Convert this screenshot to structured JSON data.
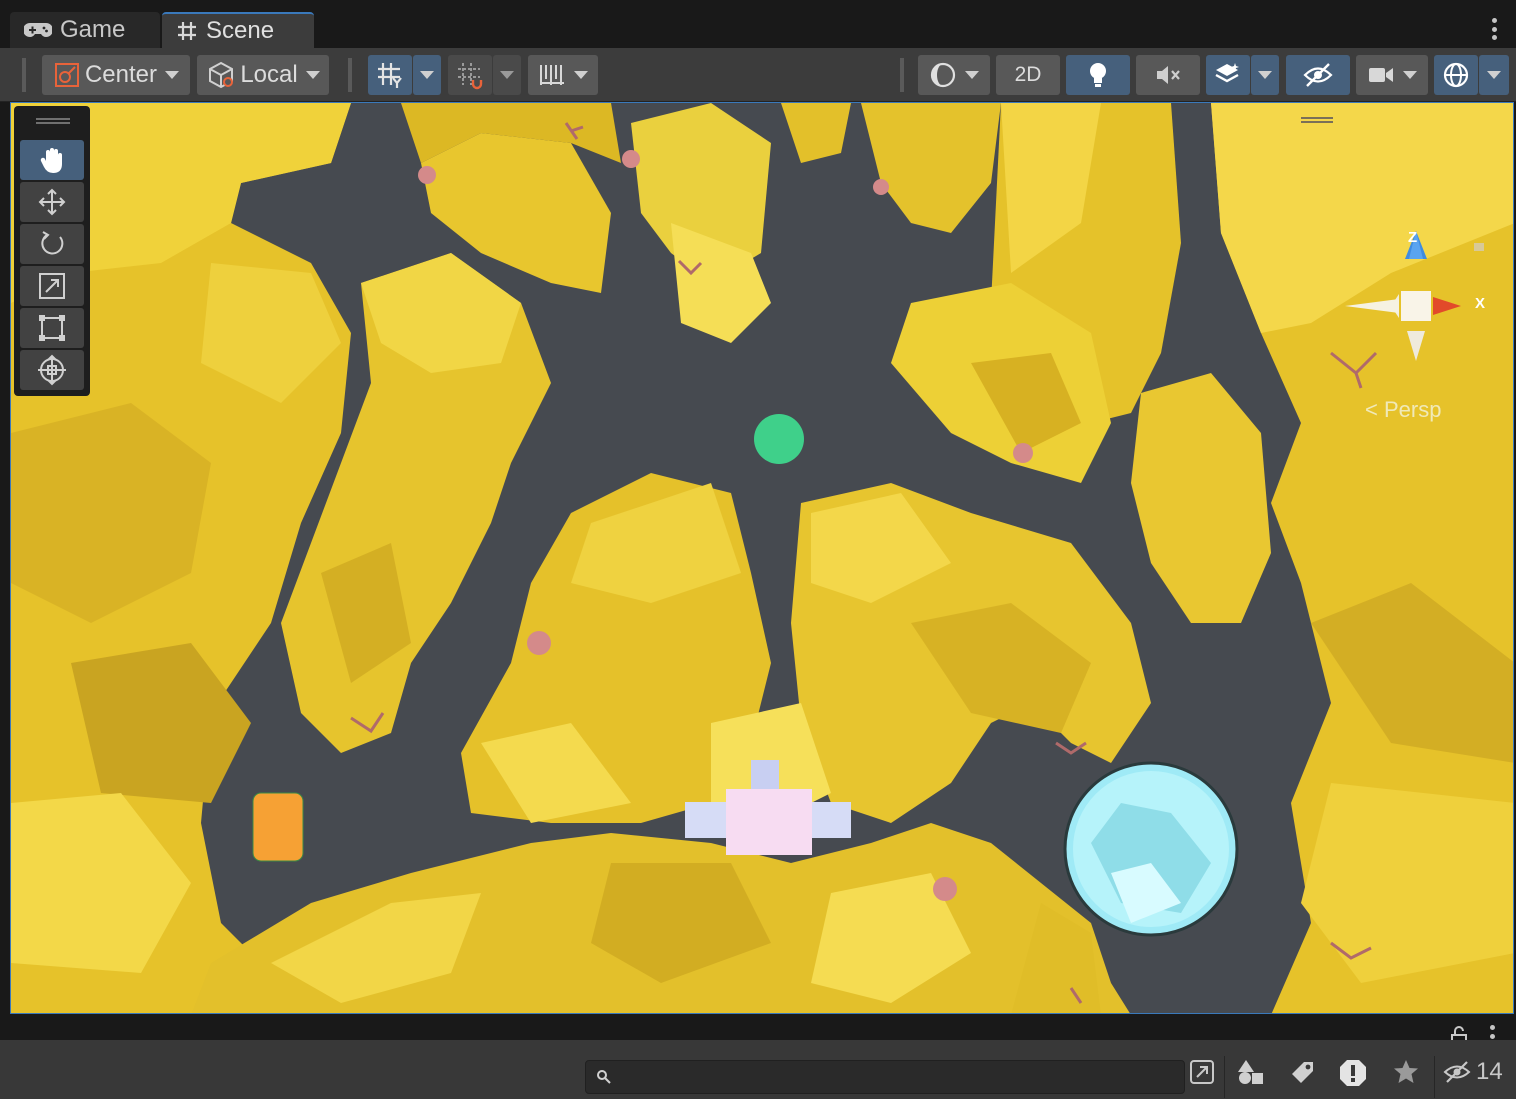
{
  "tabs": [
    {
      "label": "Game",
      "icon": "gamepad-icon",
      "active": false
    },
    {
      "label": "Scene",
      "icon": "grid-hash-icon",
      "active": true
    }
  ],
  "toolbar": {
    "pivot_label": "Center",
    "space_label": "Local",
    "mode_2d_label": "2D"
  },
  "tools": [
    {
      "name": "hand-tool",
      "icon": "hand-icon",
      "active": true
    },
    {
      "name": "move-tool",
      "icon": "move-arrows-icon",
      "active": false
    },
    {
      "name": "rotate-tool",
      "icon": "rotate-icon",
      "active": false
    },
    {
      "name": "scale-tool",
      "icon": "scale-icon",
      "active": false
    },
    {
      "name": "rect-tool",
      "icon": "rect-transform-icon",
      "active": false
    },
    {
      "name": "transform-tool",
      "icon": "transform-icon",
      "active": false
    }
  ],
  "gizmo": {
    "axis_z": "Z",
    "axis_x": "X",
    "projection_label": "< Persp"
  },
  "status": {
    "hidden_count": "14",
    "search_placeholder": ""
  },
  "colors": {
    "accent": "#3a79bb",
    "terrain": "#e8c22c",
    "floor": "#464a50",
    "goal": "#3fd08a",
    "player": "#f6a134",
    "portal": "#a8f0f8"
  }
}
